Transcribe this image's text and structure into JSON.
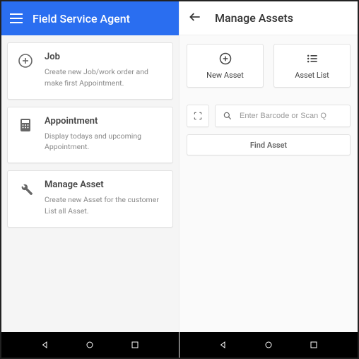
{
  "left": {
    "appbar_title": "Field Service Agent",
    "cards": [
      {
        "title": "Job",
        "desc": "Create new Job/work order and make first Appointment."
      },
      {
        "title": "Appointment",
        "desc": "Display todays and upcoming Appointment."
      },
      {
        "title": "Manage Asset",
        "desc": "Create new Asset for the customer List all Asset."
      }
    ]
  },
  "right": {
    "appbar_title": "Manage Assets",
    "actions": {
      "new_asset": "New Asset",
      "asset_list": "Asset List"
    },
    "search_placeholder": "Enter Barcode or Scan Q",
    "find_label": "Find Asset"
  }
}
